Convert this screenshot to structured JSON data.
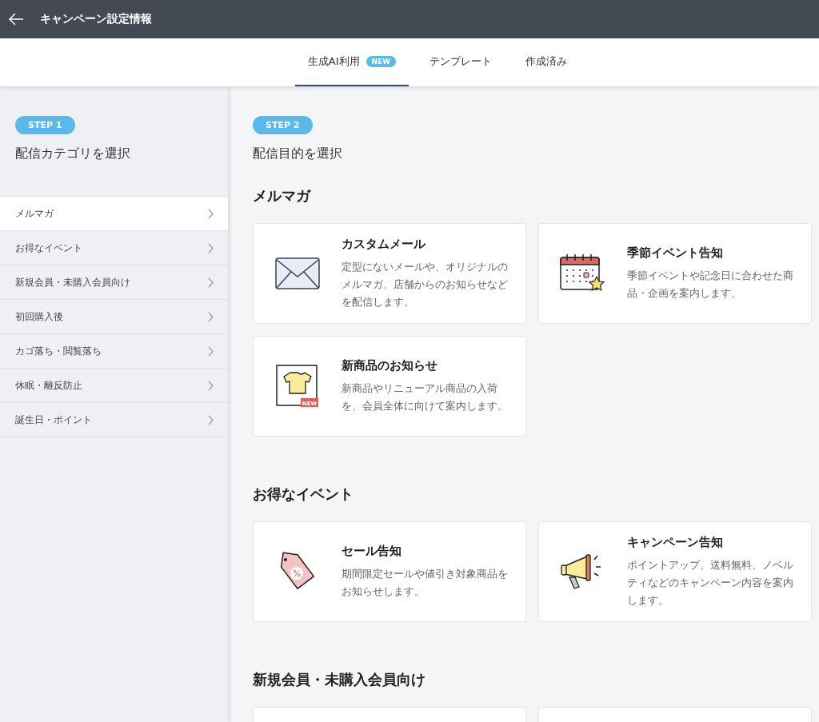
{
  "header": {
    "title": "キャンペーン設定情報"
  },
  "tabs": [
    {
      "label": "生成AI利用",
      "badge": "NEW",
      "selected": true
    },
    {
      "label": "テンプレート",
      "selected": false
    },
    {
      "label": "作成済み",
      "selected": false
    }
  ],
  "sidebar": {
    "step": "STEP 1",
    "heading": "配信カテゴリを選択",
    "items": [
      {
        "label": "メルマガ",
        "selected": true
      },
      {
        "label": "お得なイベント",
        "selected": false
      },
      {
        "label": "新規会員・未購入会員向け",
        "selected": false
      },
      {
        "label": "初回購入後",
        "selected": false
      },
      {
        "label": "カゴ落ち・閲覧落ち",
        "selected": false
      },
      {
        "label": "休眠・離反防止",
        "selected": false
      },
      {
        "label": "誕生日・ポイント",
        "selected": false
      }
    ]
  },
  "main": {
    "step": "STEP 2",
    "heading": "配信目的を選択",
    "sections": [
      {
        "title": "メルマガ",
        "cards": [
          {
            "kind": "envelope",
            "title": "カスタムメール",
            "description": "定型にないメールや、オリジナルのメルマガ、店舗からのお知らせなどを配信します。"
          },
          {
            "kind": "calendar",
            "title": "季節イベント告知",
            "description": "季節イベントや記念日に合わせた商品・企画を案内します。"
          },
          {
            "kind": "shirt",
            "title": "新商品のお知らせ",
            "description": "新商品やリニューアル商品の入荷を、会員全体に向けて案内します。",
            "badge": "NEW"
          }
        ]
      },
      {
        "title": "お得なイベント",
        "cards": [
          {
            "kind": "tag",
            "symbol": "%",
            "title": "セール告知",
            "description": "期間限定セールや値引き対象商品をお知らせします。"
          },
          {
            "kind": "megaphone",
            "title": "キャンペーン告知",
            "description": "ポイントアップ、送料無料、ノベルティなどのキャンペーン内容を案内します。"
          }
        ]
      },
      {
        "title": "新規会員・未購入会員向け",
        "cards": [
          {
            "kind": "cut"
          },
          {
            "kind": "cut"
          }
        ]
      }
    ]
  }
}
